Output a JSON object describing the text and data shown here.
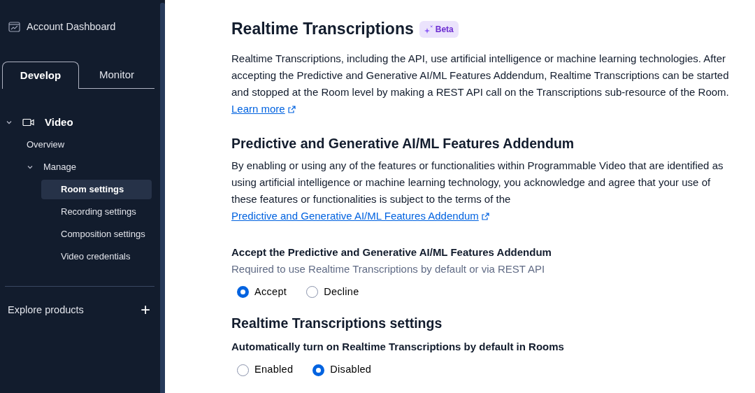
{
  "sidebar": {
    "account": {
      "label": "Account Dashboard"
    },
    "tabs": [
      {
        "label": "Develop",
        "selected": true
      },
      {
        "label": "Monitor",
        "selected": false
      }
    ],
    "nav": [
      {
        "label": "Video",
        "expanded": true,
        "selected": false,
        "children": [
          {
            "label": "Overview",
            "selected": false
          },
          {
            "label": "Manage",
            "expanded": true,
            "selected": false,
            "children": [
              {
                "label": "Room settings",
                "selected": true
              },
              {
                "label": "Recording settings",
                "selected": false
              },
              {
                "label": "Composition settings",
                "selected": false
              },
              {
                "label": "Video credentials",
                "selected": false
              }
            ]
          }
        ]
      }
    ],
    "explore": {
      "label": "Explore products",
      "button": "+"
    }
  },
  "main": {
    "title": "Realtime Transcriptions",
    "badge": "Beta",
    "intro": [
      {
        "kind": "text",
        "text": "Realtime Transcriptions, including the API, use artificial intelligence or machine learning technologies. After accepting the Predictive and Generative AI/ML Features Addendum, Realtime Transcriptions can be started and stopped at the Room level by making a REST API call on the Transcriptions sub-resource of the Room. "
      },
      {
        "kind": "link",
        "text": "Learn more"
      }
    ],
    "addendum_heading": "Predictive and Generative AI/ML Features Addendum",
    "addendum_text": [
      {
        "kind": "text",
        "text": "By enabling or using any of the features or functionalities within Programmable Video that are identified as using artificial intelligence or machine learning technology, you acknowledge and agree that your use of these features or functionalities is subject to the terms of the "
      },
      {
        "kind": "link",
        "text": "Predictive and Generative AI/ML Features Addendum"
      }
    ],
    "groups": [
      {
        "label": "Accept the Predictive and Generative AI/ML Features Addendum",
        "hint": "Required to use Realtime Transcriptions by default or via REST API",
        "options": [
          {
            "label": "Accept",
            "selected": true
          },
          {
            "label": "Decline",
            "selected": false
          }
        ]
      },
      {
        "heading": "Realtime Transcriptions settings",
        "label": "Automatically turn on Realtime Transcriptions by default in Rooms",
        "options": [
          {
            "label": "Enabled",
            "selected": false
          },
          {
            "label": "Disabled",
            "selected": true
          }
        ]
      }
    ]
  }
}
